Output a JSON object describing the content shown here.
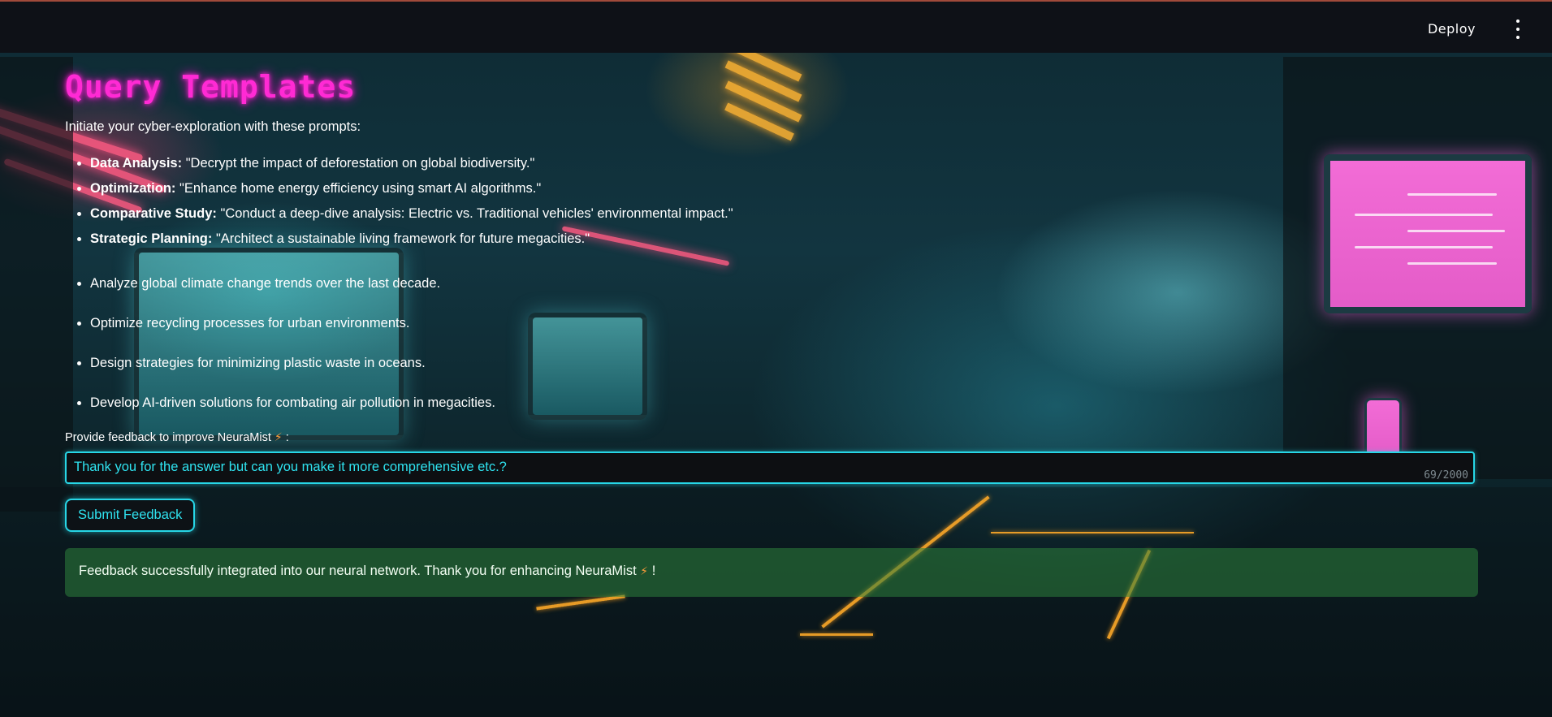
{
  "header": {
    "deploy_label": "Deploy",
    "menu_icon": "kebab-menu-icon"
  },
  "main": {
    "title": "Query Templates",
    "intro": "Initiate your cyber-exploration with these prompts:",
    "templates": [
      {
        "label": "Data Analysis:",
        "text": " \"Decrypt the impact of deforestation on global biodiversity.\""
      },
      {
        "label": "Optimization:",
        "text": " \"Enhance home energy efficiency using smart AI algorithms.\""
      },
      {
        "label": "Comparative Study:",
        "text": " \"Conduct a deep-dive analysis: Electric vs. Traditional vehicles' environmental impact.\""
      },
      {
        "label": "Strategic Planning:",
        "text": " \"Architect a sustainable living framework for future megacities.\""
      }
    ],
    "suggestions": [
      "Analyze global climate change trends over the last decade.",
      "Optimize recycling processes for urban environments.",
      "Design strategies for minimizing plastic waste in oceans.",
      "Develop AI-driven solutions for combating air pollution in megacities."
    ],
    "feedback": {
      "label_prefix": "Provide feedback to improve NeuraMist",
      "label_suffix": ":",
      "value": "Thank you for the answer but can you make it more comprehensive etc.?",
      "char_count": "69/2000",
      "submit_label": "Submit Feedback"
    },
    "success": {
      "prefix": "Feedback successfully integrated into our neural network. Thank you for enhancing NeuraMist",
      "suffix": "!"
    },
    "bolt_glyph": "⚡",
    "colors": {
      "title": "#ff2ad4",
      "accent": "#27d6e6",
      "success_bg": "#2e823c"
    }
  }
}
